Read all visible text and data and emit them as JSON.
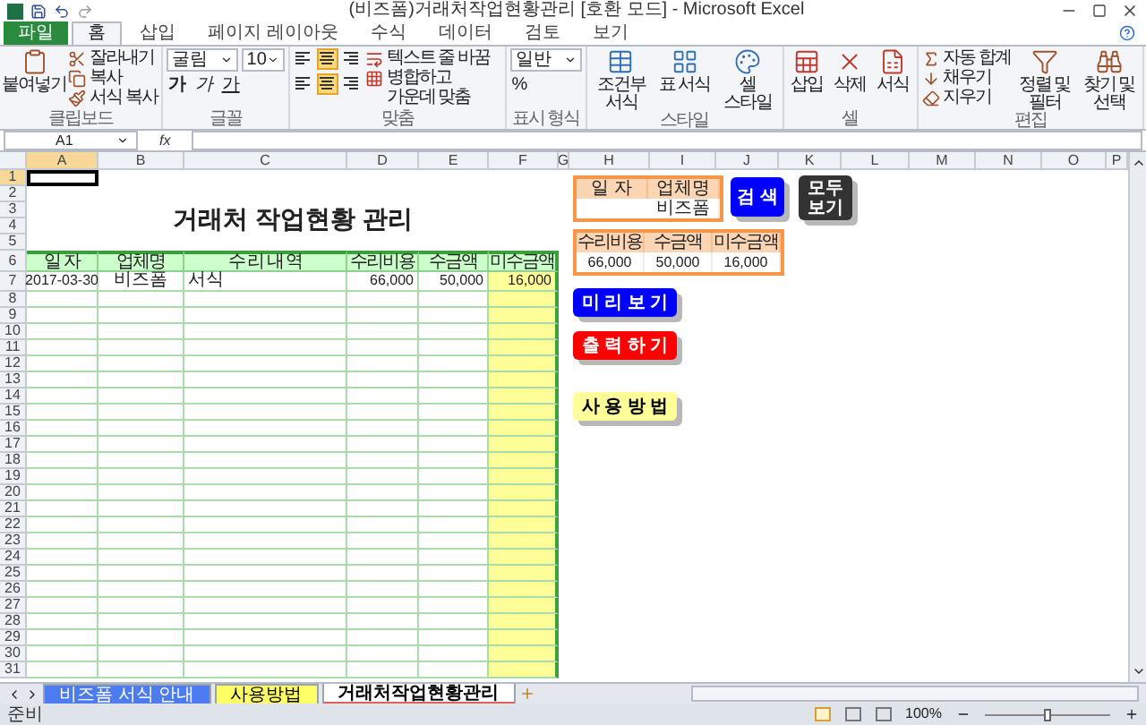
{
  "window": {
    "title": "(비즈폼)거래처작업현황관리 [호환 모드] - Microsoft Excel"
  },
  "ribbon_tabs": [
    {
      "label": "파일",
      "kind": "file",
      "selected": false
    },
    {
      "label": "홈",
      "kind": "tab",
      "selected": true
    },
    {
      "label": "삽입",
      "kind": "tab",
      "selected": false
    },
    {
      "label": "페이지 레이아웃",
      "kind": "tab",
      "selected": false
    },
    {
      "label": "수식",
      "kind": "tab",
      "selected": false
    },
    {
      "label": "데이터",
      "kind": "tab",
      "selected": false
    },
    {
      "label": "검토",
      "kind": "tab",
      "selected": false
    },
    {
      "label": "보기",
      "kind": "tab",
      "selected": false
    }
  ],
  "ribbon_groups": [
    {
      "label": "클립보드",
      "columns": [
        [
          {
            "kind": "large",
            "label": "붙여넣기"
          }
        ],
        [
          {
            "kind": "small",
            "label": "잘라내기"
          },
          {
            "kind": "small",
            "label": "복사"
          },
          {
            "kind": "small",
            "label": "서식 복사"
          }
        ]
      ]
    },
    {
      "label": "글꼴",
      "columns": [
        [
          {
            "kind": "fields",
            "values": [
              "굴림",
              "10"
            ]
          },
          {
            "kind": "font_styles",
            "buttons": [
              {
                "label": "가"
              },
              {
                "label": "가"
              },
              {
                "label": "가"
              }
            ]
          }
        ]
      ]
    },
    {
      "label": "맞춤",
      "columns": [
        [
          {
            "kind": "align",
            "buttons": [
              {
                "selected": false
              },
              {
                "selected": true
              },
              {
                "selected": false
              }
            ]
          },
          {
            "kind": "align",
            "buttons": [
              {
                "selected": false
              },
              {
                "selected": true
              },
              {
                "selected": false
              }
            ]
          }
        ],
        [
          {
            "kind": "small",
            "label": "텍스트 줄 바꿈"
          },
          {
            "kind": "small",
            "label": "병합하고 가운데 맞춤"
          }
        ]
      ]
    },
    {
      "label": "표시 형식",
      "columns": [
        [
          {
            "kind": "fields",
            "values": [
              "일반"
            ]
          },
          {
            "kind": "glyphs",
            "buttons": [
              {
                "label": "%"
              }
            ]
          }
        ]
      ]
    },
    {
      "label": "스타일",
      "columns": [
        [
          {
            "kind": "large",
            "label": "조건부 서식"
          }
        ],
        [
          {
            "kind": "large",
            "label": "표 서식"
          }
        ],
        [
          {
            "kind": "large",
            "label": "셀 스타일"
          }
        ]
      ]
    },
    {
      "label": "셀",
      "columns": [
        [
          {
            "kind": "large",
            "label": "삽입"
          }
        ],
        [
          {
            "kind": "large",
            "label": "삭제"
          }
        ],
        [
          {
            "kind": "large",
            "label": "서식"
          }
        ]
      ]
    },
    {
      "label": "편집",
      "columns": [
        [
          {
            "kind": "small",
            "label": "자동 합계"
          },
          {
            "kind": "small",
            "label": "채우기"
          },
          {
            "kind": "small",
            "label": "지우기"
          }
        ],
        [
          {
            "kind": "large",
            "label": "정렬 및 필터"
          }
        ],
        [
          {
            "kind": "large",
            "label": "찾기 및 선택"
          }
        ]
      ]
    }
  ],
  "formula_bar": {
    "name_box": "A1",
    "function_label": "fx"
  },
  "sheet": {
    "column_headers": [
      "A",
      "B",
      "C",
      "D",
      "E",
      "F",
      "G",
      "H",
      "I",
      "J",
      "K",
      "L",
      "M",
      "N",
      "O",
      "P"
    ],
    "row_headers": [
      "1",
      "2",
      "3",
      "4",
      "5",
      "6",
      "7",
      "8",
      "9",
      "10",
      "11",
      "12",
      "13",
      "14",
      "15",
      "16",
      "17",
      "18",
      "19",
      "20",
      "21",
      "22",
      "23",
      "24",
      "25",
      "26",
      "27",
      "28",
      "29",
      "30",
      "31"
    ],
    "title": "거래처 작업현황 관리",
    "table": {
      "columns": [
        "일 자",
        "업체명",
        "수 리 내 역",
        "수리비용",
        "수금액",
        "미수금액"
      ],
      "rows": [
        [
          "2017-03-30",
          "비즈폼",
          "서식",
          "66,000",
          "50,000",
          "16,000"
        ]
      ]
    }
  },
  "search_panel": [
    {
      "label": "일 자"
    },
    {
      "label": "업체명",
      "value": "비즈폼"
    }
  ],
  "summary_panel": [
    {
      "label": "수리비용",
      "value": "66,000"
    },
    {
      "label": "수금액",
      "value": "50,000"
    },
    {
      "label": "미수금액",
      "value": "16,000"
    }
  ],
  "buttons": [
    {
      "label": "검 색",
      "color": "#0000ff"
    },
    {
      "label": "모두 보기",
      "color": "#333333"
    },
    {
      "label": "미 리 보 기",
      "color": "#0000ff"
    },
    {
      "label": "출 력 하 기",
      "color": "#ff0000"
    },
    {
      "label": "사 용 방 법",
      "color": "#ffff99"
    }
  ],
  "sheet_tabs": [
    {
      "label": "비즈폼 서식 안내",
      "color": "#4d7cf0",
      "selected": false
    },
    {
      "label": "사용방법",
      "color": "#ffff66",
      "selected": false
    },
    {
      "label": "거래처작업현황관리",
      "color": "#ffffff",
      "selected": true
    }
  ],
  "status_bar": {
    "status": "준비",
    "zoom": "100%",
    "zoom_slider": {
      "level": 0.5
    }
  }
}
